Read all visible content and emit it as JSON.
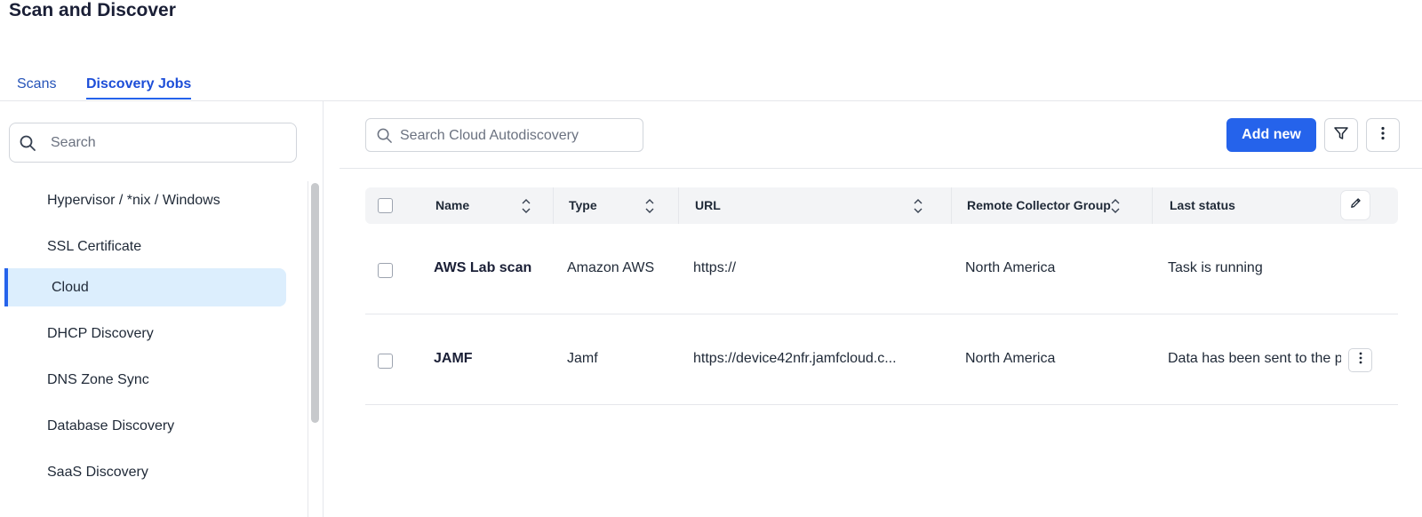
{
  "page": {
    "title": "Scan and Discover"
  },
  "tabs": [
    {
      "label": "Scans",
      "active": false
    },
    {
      "label": "Discovery Jobs",
      "active": true
    }
  ],
  "sidebar": {
    "search_placeholder": "Search",
    "items": [
      {
        "label": "Hypervisor / *nix / Windows",
        "active": false
      },
      {
        "label": "SSL Certificate",
        "active": false
      },
      {
        "label": "Cloud",
        "active": true
      },
      {
        "label": "DHCP Discovery",
        "active": false
      },
      {
        "label": "DNS Zone Sync",
        "active": false
      },
      {
        "label": "Database Discovery",
        "active": false
      },
      {
        "label": "SaaS Discovery",
        "active": false
      }
    ]
  },
  "toolbar": {
    "search_placeholder": "Search Cloud Autodiscovery",
    "add_label": "Add new",
    "filter_icon": "filter-icon",
    "more_icon": "more-vertical-icon"
  },
  "table": {
    "columns": [
      "Name",
      "Type",
      "URL",
      "Remote Collector Group",
      "Last status"
    ],
    "rows": [
      {
        "name": "AWS Lab scan",
        "type": "Amazon AWS",
        "url": "https://",
        "group": "North America",
        "status": "Task is running"
      },
      {
        "name": "JAMF",
        "type": "Jamf",
        "url": "https://device42nfr.jamfcloud.c...",
        "group": "North America",
        "status": "Data has been sent to the p"
      }
    ]
  },
  "colors": {
    "accent": "#2563eb",
    "active_bg": "#dceefd"
  }
}
